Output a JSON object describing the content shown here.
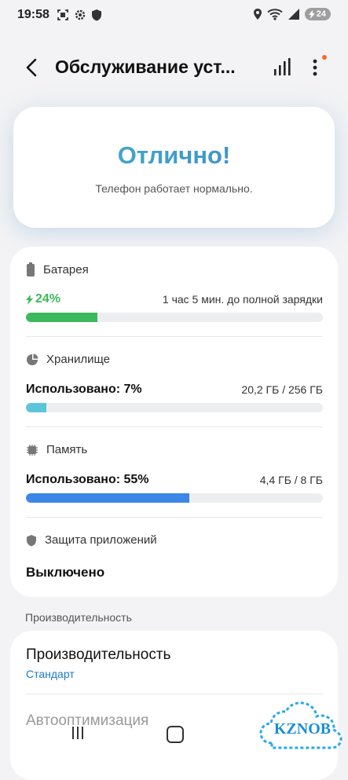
{
  "status_bar": {
    "time": "19:58",
    "battery_level": "24"
  },
  "app_bar": {
    "title": "Обслуживание уст..."
  },
  "status_card": {
    "title": "Отлично!",
    "subtitle": "Телефон работает нормально."
  },
  "battery": {
    "label": "Батарея",
    "percent_text": "24%",
    "charge_time": "1 час 5 мин. до полной зарядки",
    "level": 0.24,
    "color": "#3cb95a"
  },
  "storage": {
    "label": "Хранилище",
    "used_text": "Использовано: 7%",
    "amount": "20,2 ГБ / 256 ГБ",
    "level": 0.07,
    "color": "#5cc6d8"
  },
  "memory": {
    "label": "Память",
    "used_text": "Использовано: 55%",
    "amount": "4,4 ГБ / 8 ГБ",
    "level": 0.55,
    "color": "#3b86e6"
  },
  "app_protection": {
    "label": "Защита приложений",
    "state": "Выключено"
  },
  "performance": {
    "section_label": "Производительность",
    "title": "Производительность",
    "mode": "Стандарт",
    "auto_optimization": "Автооптимизация"
  },
  "watermark": {
    "text": "KZNOB"
  }
}
